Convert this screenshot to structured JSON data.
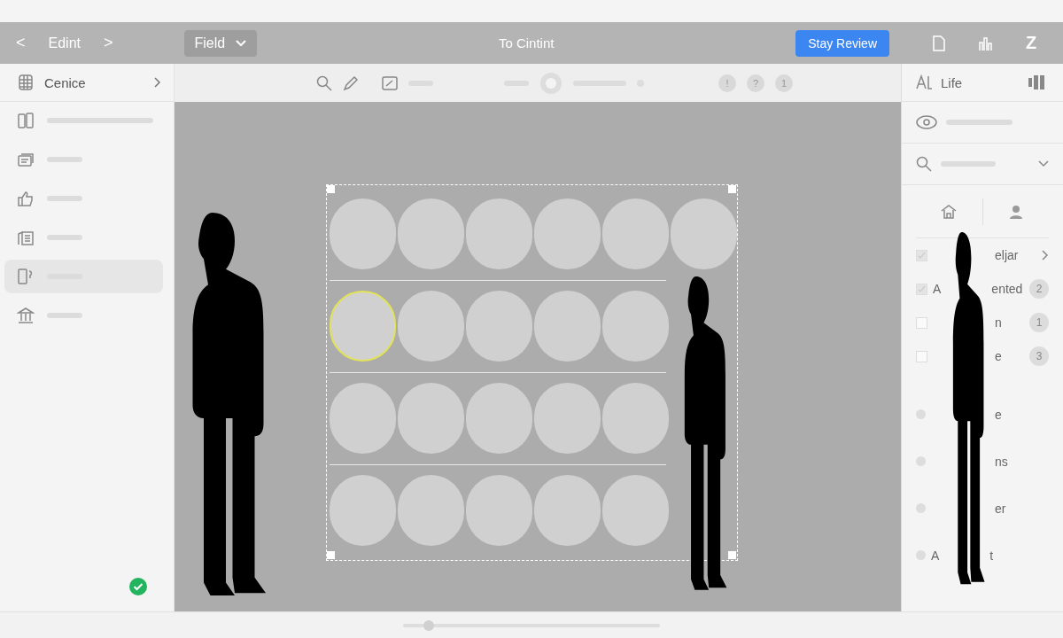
{
  "top_bar": {
    "back": "<",
    "title": "Edint",
    "forward": ">",
    "field_dropdown": "Field",
    "document_title": "To Cintint",
    "primary_button": "Stay Review",
    "end_glyph": "Z"
  },
  "sidebar": {
    "header": "Cenice",
    "items": [
      {
        "selected": false
      },
      {
        "selected": false
      },
      {
        "selected": false
      },
      {
        "selected": false
      },
      {
        "selected": true
      },
      {
        "selected": false
      }
    ]
  },
  "toolbar": {
    "badges": [
      "!",
      "?",
      "1"
    ]
  },
  "canvas": {
    "rows": [
      {
        "cells": [
          {
            "selected": false
          },
          {
            "selected": false
          },
          {
            "selected": false
          },
          {
            "selected": false
          },
          {
            "selected": false
          },
          {
            "selected": false
          }
        ]
      },
      {
        "cells": [
          {
            "selected": true
          },
          {
            "selected": false
          },
          {
            "selected": false
          },
          {
            "selected": false
          },
          {
            "selected": false
          }
        ]
      },
      {
        "cells": [
          {
            "selected": false
          },
          {
            "selected": false
          },
          {
            "selected": false
          },
          {
            "selected": false
          },
          {
            "selected": false
          }
        ]
      },
      {
        "cells": [
          {
            "selected": false
          },
          {
            "selected": false
          },
          {
            "selected": false
          },
          {
            "selected": false
          },
          {
            "selected": false
          }
        ]
      }
    ]
  },
  "zoom_slider": {
    "level": 0.1
  },
  "right_panel": {
    "header": "Life",
    "list": [
      {
        "kind": "check",
        "checked": true,
        "label": "eljar",
        "chevron": true
      },
      {
        "kind": "check",
        "checked": true,
        "prefix": "A",
        "label": "ented",
        "count": "2"
      },
      {
        "kind": "check",
        "checked": false,
        "label": "n",
        "count": "1"
      },
      {
        "kind": "check",
        "checked": false,
        "label": "e",
        "count": "3"
      },
      {
        "kind": "dot",
        "label": "e"
      },
      {
        "kind": "dot",
        "label": "ns"
      },
      {
        "kind": "dot",
        "label": "er"
      },
      {
        "kind": "dot",
        "prefix": "A",
        "label": "t"
      }
    ]
  }
}
